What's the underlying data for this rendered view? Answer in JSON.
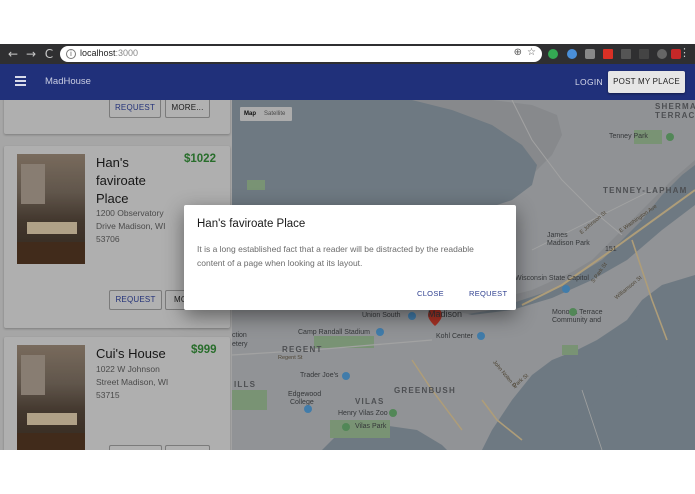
{
  "browser": {
    "back_icon": "←",
    "forward_icon": "→",
    "reload_icon": "C",
    "url_host": "localhost",
    "url_port": ":3000",
    "menu_icon": "⋮"
  },
  "appbar": {
    "brand": "MadHouse",
    "login_label": "LOGIN",
    "post_label": "POST MY PLACE",
    "color": "#20307a"
  },
  "listings": [
    {
      "title": "",
      "price": "",
      "address": "",
      "request_label": "REQUEST",
      "more_label": "MORE..."
    },
    {
      "title_lines": [
        "Han's",
        "faviroate",
        "Place"
      ],
      "price": "$1022",
      "address_lines": [
        "1200 Observatory",
        "Drive Madison, WI",
        "53706"
      ],
      "request_label": "REQUEST",
      "more_label": "MO"
    },
    {
      "title": "Cui's House",
      "price": "$999",
      "address_lines": [
        "1022 W Johnson",
        "Street Madison, WI",
        "53715"
      ]
    }
  ],
  "map": {
    "type_map": "Map",
    "type_satellite": "Satellite",
    "labels": {
      "sherman": "SHERMA",
      "terrace": "TERRAC",
      "tenney_park": "Tenney Park",
      "tenney_lapham": "TENNEY-LAPHAM",
      "james_madison_park_1": "James",
      "james_madison_park_2": "Madison Park",
      "capitol": "Wisconsin State Capitol",
      "monona_1": "Monona Terrace",
      "monona_2": "Community and",
      "union_south": "Union South",
      "madison": "Madison",
      "kohl": "Kohl Center",
      "camp_randall": "Camp Randall Stadium",
      "regent": "REGENT",
      "trader_joes": "Trader Joe's",
      "hills": "ILLS",
      "edgewood_1": "Edgewood",
      "edgewood_2": "College",
      "vilas": "VILAS",
      "greenbush": "GREENBUSH",
      "henry_vilas": "Henry Vilas Zoo",
      "vilas_park": "Vilas Park",
      "ction": "ction",
      "etery": "etery",
      "e_washington": "E Washington Ave",
      "regent_st": "Regent St",
      "park_st": "Park St",
      "john_nolen": "John Nolen Dr",
      "s_park": "S Park St",
      "williamson": "Williamson St",
      "e_johnson": "E Johnson St",
      "hwy_151": "151"
    }
  },
  "dialog": {
    "title": "Han's faviroate Place",
    "body": "It is a long established fact that a reader will be distracted by the readable content of a page when looking at its layout.",
    "close_label": "CLOSE",
    "request_label": "REQUEST"
  }
}
